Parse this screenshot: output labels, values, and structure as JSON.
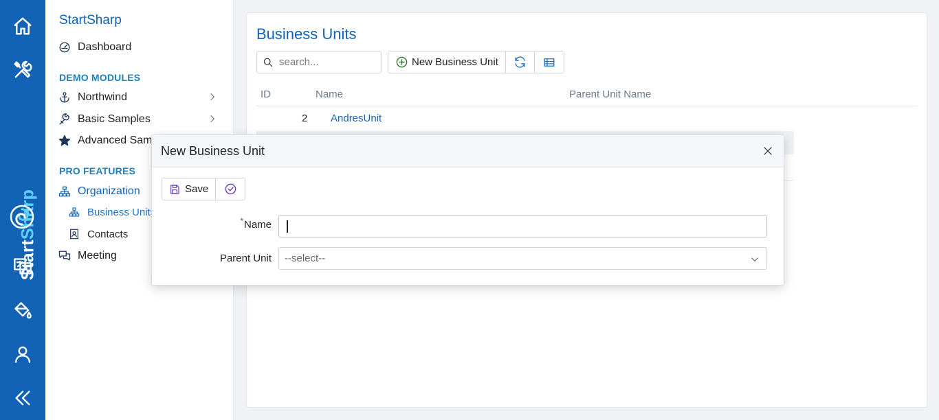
{
  "rail": {
    "brand_part1": "Start",
    "brand_part2": "Sharp",
    "icons": [
      "home-icon",
      "tools-icon",
      "translate-icon",
      "paint-bucket-icon",
      "user-icon",
      "collapse-icon"
    ]
  },
  "sidebar": {
    "title": "StartSharp",
    "dashboard": "Dashboard",
    "demo_header": "DEMO MODULES",
    "northwind": "Northwind",
    "basic_samples": "Basic Samples",
    "advanced_samples": "Advanced Samples",
    "pro_header": "PRO FEATURES",
    "organization": "Organization",
    "business_units": "Business Units",
    "contacts": "Contacts",
    "meeting": "Meeting"
  },
  "main": {
    "title": "Business Units",
    "search_placeholder": "search...",
    "new_button": "New Business Unit",
    "columns": {
      "id": "ID",
      "name": "Name",
      "parent": "Parent Unit Name"
    },
    "rows": [
      {
        "id": "2",
        "name": "AndresUnit",
        "parent": ""
      }
    ]
  },
  "dialog": {
    "title": "New Business Unit",
    "save_label": "Save",
    "name_label": "Name",
    "name_value": "",
    "parent_label": "Parent Unit",
    "parent_value": "--select--"
  },
  "colors": {
    "brand": "#1262b5",
    "accent_light": "#5fd0ff",
    "section_header": "#1e7fb8",
    "required": "#d9263b"
  }
}
